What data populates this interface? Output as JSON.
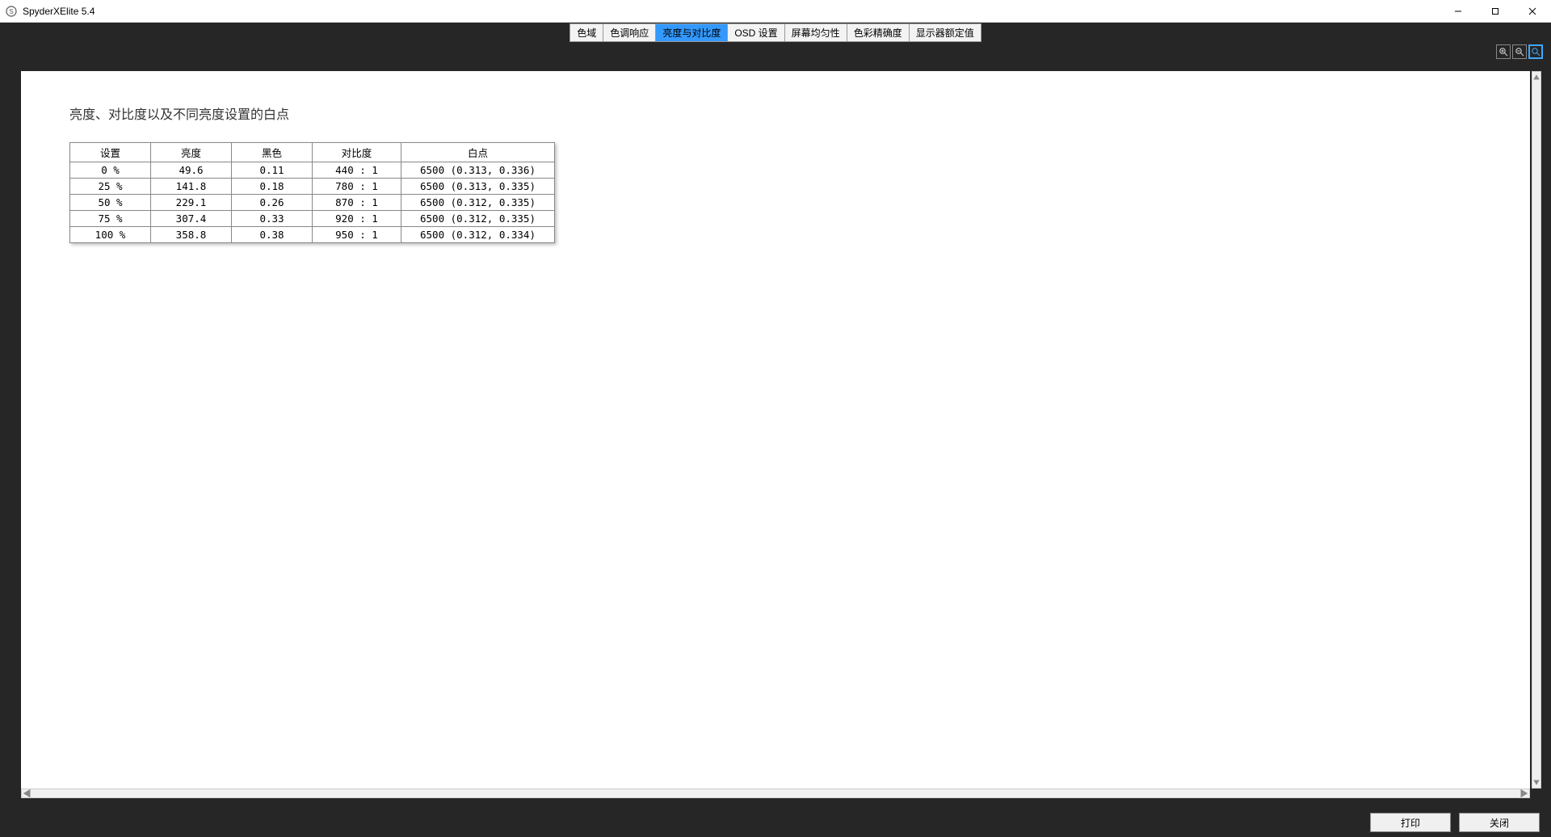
{
  "window": {
    "title": "SpyderXElite 5.4"
  },
  "tabs": [
    {
      "label": "色域"
    },
    {
      "label": "色调响应"
    },
    {
      "label": "亮度与对比度",
      "active": true
    },
    {
      "label": "OSD 设置"
    },
    {
      "label": "屏幕均匀性"
    },
    {
      "label": "色彩精确度"
    },
    {
      "label": "显示器额定值"
    }
  ],
  "section_title": "亮度、对比度以及不同亮度设置的白点",
  "table": {
    "headers": [
      "设置",
      "亮度",
      "黑色",
      "对比度",
      "白点"
    ],
    "rows": [
      {
        "setting": "0 %",
        "brightness": "49.6",
        "black": "0.11",
        "contrast": "440 : 1",
        "whitepoint": "6500 (0.313, 0.336)"
      },
      {
        "setting": "25 %",
        "brightness": "141.8",
        "black": "0.18",
        "contrast": "780 : 1",
        "whitepoint": "6500 (0.313, 0.335)"
      },
      {
        "setting": "50 %",
        "brightness": "229.1",
        "black": "0.26",
        "contrast": "870 : 1",
        "whitepoint": "6500 (0.312, 0.335)"
      },
      {
        "setting": "75 %",
        "brightness": "307.4",
        "black": "0.33",
        "contrast": "920 : 1",
        "whitepoint": "6500 (0.312, 0.335)"
      },
      {
        "setting": "100 %",
        "brightness": "358.8",
        "black": "0.38",
        "contrast": "950 : 1",
        "whitepoint": "6500 (0.312, 0.334)"
      }
    ]
  },
  "footer": {
    "print": "打印",
    "close": "关闭"
  },
  "chart_data": {
    "type": "table",
    "title": "亮度、对比度以及不同亮度设置的白点",
    "columns": [
      "设置",
      "亮度",
      "黑色",
      "对比度",
      "白点"
    ],
    "rows": [
      [
        "0 %",
        49.6,
        0.11,
        "440 : 1",
        "6500 (0.313, 0.336)"
      ],
      [
        "25 %",
        141.8,
        0.18,
        "780 : 1",
        "6500 (0.313, 0.335)"
      ],
      [
        "50 %",
        229.1,
        0.26,
        "870 : 1",
        "6500 (0.312, 0.335)"
      ],
      [
        "75 %",
        307.4,
        0.33,
        "920 : 1",
        "6500 (0.312, 0.335)"
      ],
      [
        "100 %",
        358.8,
        0.38,
        "950 : 1",
        "6500 (0.312, 0.334)"
      ]
    ]
  }
}
